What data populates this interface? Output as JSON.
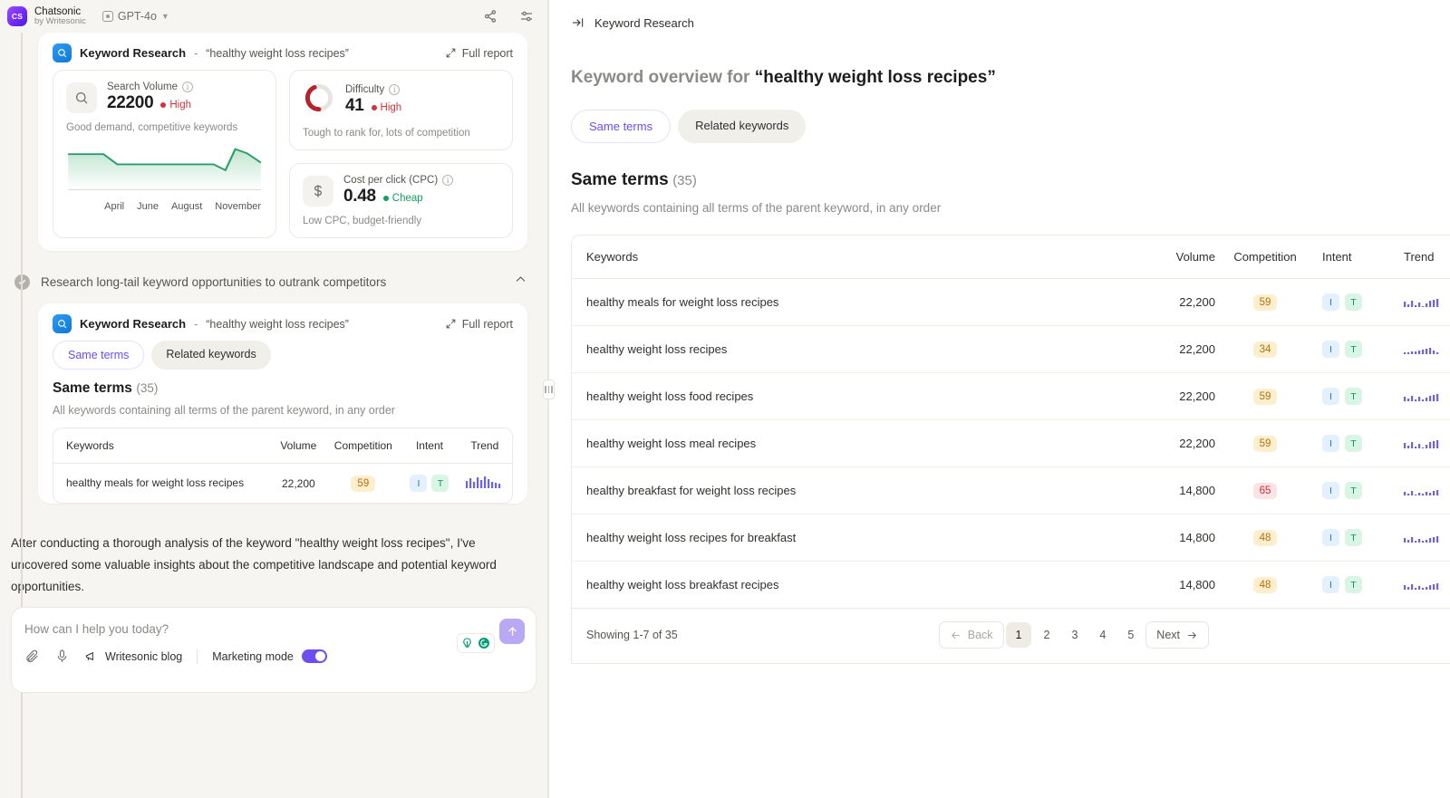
{
  "topbar": {
    "logo_text": "CS",
    "brand_name": "Chatsonic",
    "brand_sub": "by Writesonic",
    "model": "GPT-4o",
    "share_icon": "share-icon",
    "settings_icon": "sliders-icon"
  },
  "left": {
    "report_header": {
      "title": "Keyword Research",
      "dash": "-",
      "keyword": "“healthy weight loss recipes”",
      "full_report": "Full report"
    },
    "metrics": [
      {
        "label": "Search Volume",
        "value": "22200",
        "tag": "High",
        "tag_color": "#d2333a",
        "desc": "Good demand, competitive keywords",
        "icon": "magnifier-icon"
      },
      {
        "label": "Difficulty",
        "value": "41",
        "tag": "High",
        "tag_color": "#d2333a",
        "desc": "Tough to rank for, lots of competition",
        "icon": "donut-gauge-icon"
      },
      {
        "label": "Cost per click (CPC)",
        "value": "0.48",
        "tag": "Cheap",
        "tag_color": "#10a05f",
        "desc": "Low CPC, budget-friendly",
        "icon": "dollar-icon"
      }
    ],
    "step": {
      "text": "Research long-tail keyword opportunities to outrank competitors",
      "state_icon": "check-circle-icon",
      "collapse_icon": "chevron-up-icon"
    },
    "card2_header": {
      "title": "Keyword Research",
      "dash": "-",
      "keyword": "“healthy weight loss recipes”",
      "full_report": "Full report"
    },
    "tabs": [
      {
        "label": "Same terms",
        "active": true
      },
      {
        "label": "Related keywords",
        "active": false
      }
    ],
    "section": {
      "title": "Same terms",
      "count": "(35)",
      "subtitle": "All keywords containing all terms of the parent keyword, in any order"
    },
    "table": {
      "columns": [
        "Keywords",
        "Volume",
        "Competition",
        "Intent",
        "Trend"
      ],
      "rows": [
        {
          "keyword": "healthy meals for weight loss recipes",
          "volume": "22,200",
          "competition": "59",
          "competition_bg": "#fdeecd",
          "competition_fg": "#b4700f",
          "intent": [
            "I",
            "T"
          ]
        }
      ]
    },
    "assistant_message": "After conducting a thorough analysis of the keyword \"healthy weight loss recipes\", I've uncovered some valuable insights about the competitive landscape and potential keyword opportunities.",
    "composer": {
      "placeholder": "How can I help you today?",
      "send_icon": "arrow-up-icon",
      "attach_icon": "paperclip-icon",
      "mic_icon": "microphone-icon",
      "megaphone_icon": "megaphone-icon",
      "blog_link": "Writesonic blog",
      "marketing_mode_label": "Marketing mode",
      "marketing_mode_on": true,
      "grammarly_icon": "grammarly-icon",
      "lightbulb_icon": "lightbulb-icon"
    }
  },
  "right": {
    "breadcrumb": {
      "icon": "collapse-panel-icon",
      "label": "Keyword Research"
    },
    "title_prefix": "Keyword overview for ",
    "title_keyword": "“healthy weight loss recipes”",
    "tabs": [
      {
        "label": "Same terms",
        "active": true
      },
      {
        "label": "Related keywords",
        "active": false
      }
    ],
    "section": {
      "title": "Same terms",
      "count": "(35)",
      "subtitle": "All keywords containing all terms of the parent keyword, in any order"
    },
    "table": {
      "columns": [
        "Keywords",
        "Volume",
        "Competition",
        "Intent",
        "Trend"
      ],
      "rows": [
        {
          "keyword": "healthy meals for weight loss recipes",
          "volume": "22,200",
          "competition": "59",
          "competition_bg": "#fdeecd",
          "competition_fg": "#b4700f",
          "intent": [
            "I",
            "T"
          ]
        },
        {
          "keyword": "healthy weight loss recipes",
          "volume": "22,200",
          "competition": "34",
          "competition_bg": "#fdeecd",
          "competition_fg": "#b4700f",
          "intent": [
            "I",
            "T"
          ]
        },
        {
          "keyword": "healthy weight loss food recipes",
          "volume": "22,200",
          "competition": "59",
          "competition_bg": "#fdeecd",
          "competition_fg": "#b4700f",
          "intent": [
            "I",
            "T"
          ]
        },
        {
          "keyword": "healthy weight loss meal recipes",
          "volume": "22,200",
          "competition": "59",
          "competition_bg": "#fdeecd",
          "competition_fg": "#b4700f",
          "intent": [
            "I",
            "T"
          ]
        },
        {
          "keyword": "healthy breakfast for weight loss recipes",
          "volume": "14,800",
          "competition": "65",
          "competition_bg": "#fce3e5",
          "competition_fg": "#cf2b3a",
          "intent": [
            "I",
            "T"
          ]
        },
        {
          "keyword": "healthy weight loss recipes for breakfast",
          "volume": "14,800",
          "competition": "48",
          "competition_bg": "#fdeecd",
          "competition_fg": "#b4700f",
          "intent": [
            "I",
            "T"
          ]
        },
        {
          "keyword": "healthy weight loss breakfast recipes",
          "volume": "14,800",
          "competition": "48",
          "competition_bg": "#fdeecd",
          "competition_fg": "#b4700f",
          "intent": [
            "I",
            "T"
          ]
        }
      ]
    },
    "pagination": {
      "showing": "Showing 1-7 of 35",
      "back": "Back",
      "next": "Next",
      "pages": [
        "1",
        "2",
        "3",
        "4",
        "5"
      ],
      "current": "1"
    }
  },
  "chart_data": {
    "type": "area",
    "title": "Search Volume trend",
    "xlabel": "",
    "ylabel": "Search volume",
    "categories": [
      "April",
      "June",
      "August",
      "November"
    ],
    "tick_labels": [
      "April",
      "June",
      "August",
      "November"
    ],
    "x": [
      0,
      1,
      2,
      3,
      4,
      5,
      6,
      7,
      8,
      9,
      10,
      11
    ],
    "values": [
      22200,
      22200,
      22200,
      18100,
      18100,
      18100,
      18100,
      18100,
      18100,
      16500,
      27100,
      19500
    ],
    "line_color": "#2a9d6b",
    "fill_gradient": [
      "#bfe5d0",
      "#ffffff"
    ],
    "grid": false,
    "legend": "none"
  }
}
